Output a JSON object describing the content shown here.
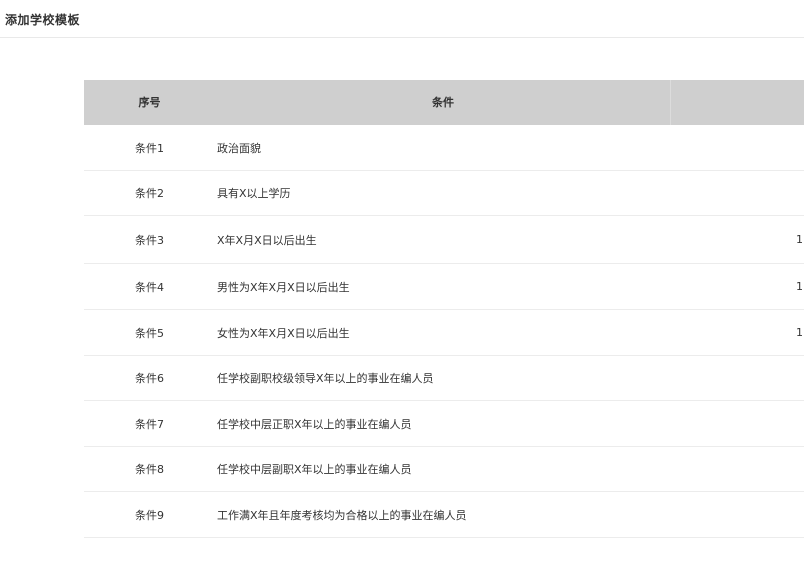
{
  "header": {
    "title": "添加学校模板"
  },
  "table": {
    "columns": {
      "seq": "序号",
      "condition": "条件",
      "extra": ""
    },
    "rows": [
      {
        "seq": "条件1",
        "condition": "政治面貌",
        "extra": ""
      },
      {
        "seq": "条件2",
        "condition": "具有X以上学历",
        "extra": ""
      },
      {
        "seq": "条件3",
        "condition": "X年X月X日以后出生",
        "extra": "1"
      },
      {
        "seq": "条件4",
        "condition": "男性为X年X月X日以后出生",
        "extra": "1"
      },
      {
        "seq": "条件5",
        "condition": "女性为X年X月X日以后出生",
        "extra": "1"
      },
      {
        "seq": "条件6",
        "condition": "任学校副职校级领导X年以上的事业在编人员",
        "extra": ""
      },
      {
        "seq": "条件7",
        "condition": "任学校中层正职X年以上的事业在编人员",
        "extra": ""
      },
      {
        "seq": "条件8",
        "condition": "任学校中层副职X年以上的事业在编人员",
        "extra": ""
      },
      {
        "seq": "条件9",
        "condition": "工作满X年且年度考核均为合格以上的事业在编人员",
        "extra": ""
      }
    ]
  }
}
